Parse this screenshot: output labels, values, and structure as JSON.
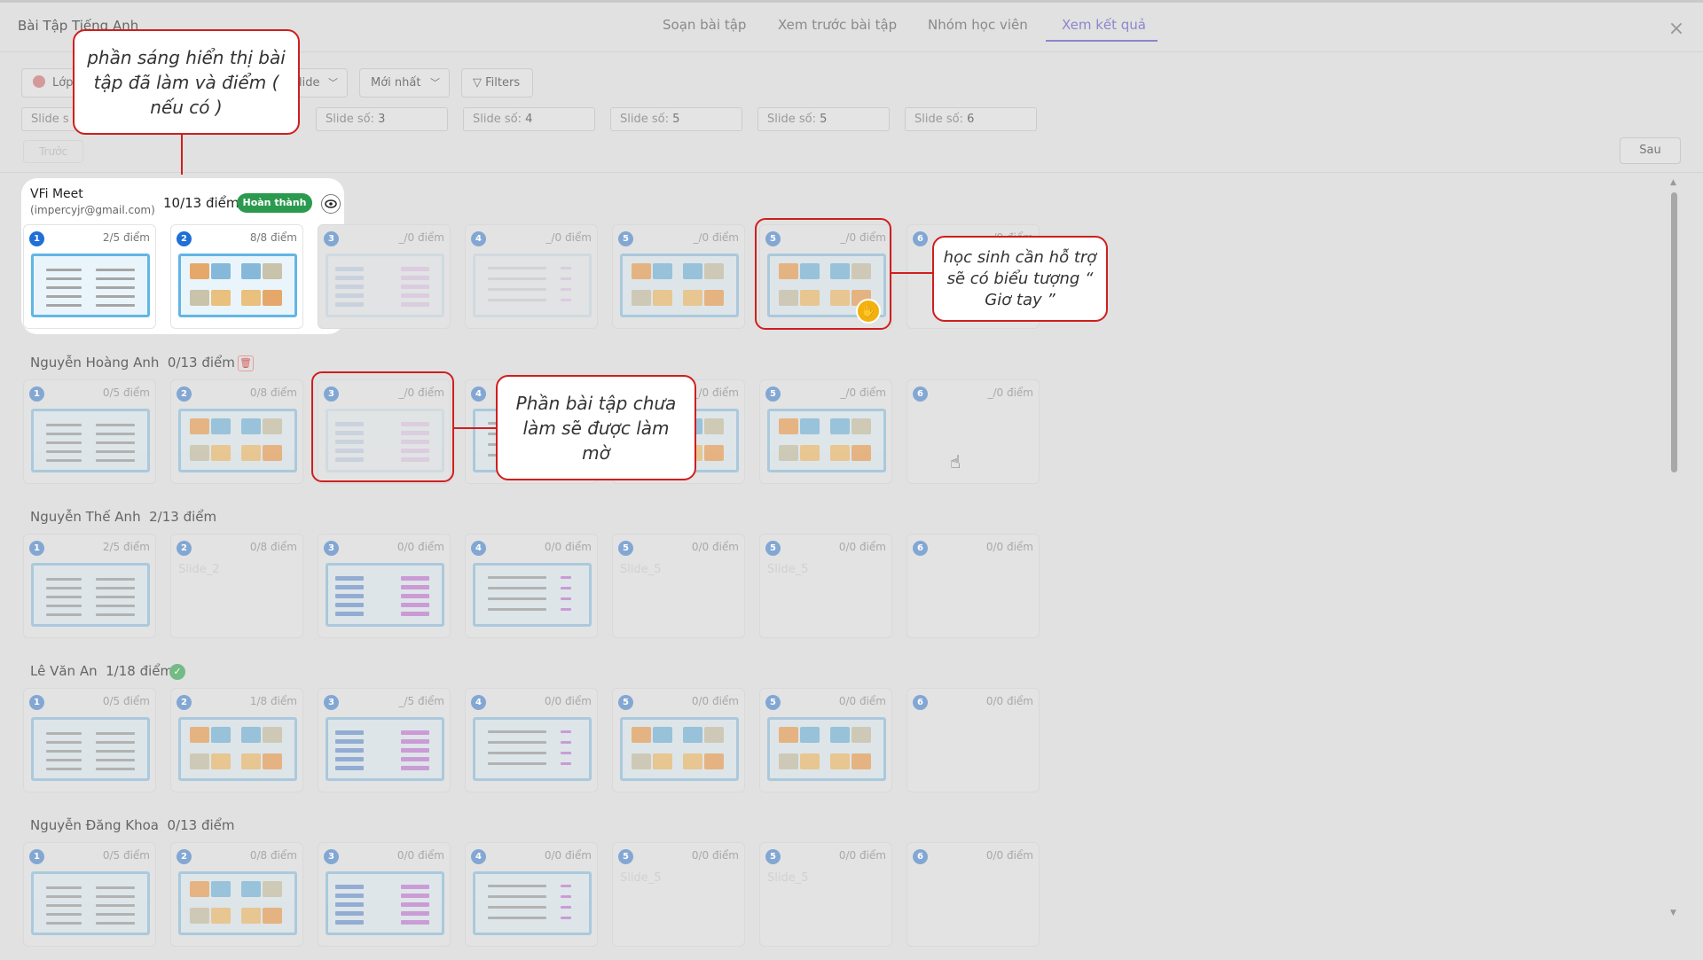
{
  "header": {
    "app_title": "Bài Tập Tiếng Anh",
    "tabs": [
      "Soạn bài tập",
      "Xem trước bài tập",
      "Nhóm học viên",
      "Xem kết quả"
    ],
    "active_tab": "Xem kết quả",
    "close_icon": "close-icon"
  },
  "toolbar": {
    "class_label": "Lớp",
    "slide_label": "lide",
    "sort_label": "Mới nhất",
    "filters_label": "Filters",
    "slide_fields": [
      {
        "prefix": "Slide s",
        "value": ""
      },
      {
        "prefix": "Slide số:",
        "value": "3"
      },
      {
        "prefix": "Slide số:",
        "value": "4"
      },
      {
        "prefix": "Slide số:",
        "value": "5"
      },
      {
        "prefix": "Slide số:",
        "value": "5"
      },
      {
        "prefix": "Slide số:",
        "value": "6"
      }
    ],
    "prev_label": "Trước",
    "next_label": "Sau"
  },
  "highlight_student": {
    "name": "VFi Meet",
    "email": "(impercyjr@gmail.com)",
    "score": "10/13 điểm",
    "status": "Hoàn thành",
    "view_icon": "eye-icon",
    "cards": [
      {
        "num": "1",
        "score": "2/5 điểm"
      },
      {
        "num": "2",
        "score": "8/8 điểm"
      },
      {
        "num": "3",
        "score": "_/0 điểm"
      },
      {
        "num": "4",
        "score": "_/0 điểm"
      },
      {
        "num": "5",
        "score": "_/0 điểm"
      },
      {
        "num": "5",
        "score": "_/0 điểm"
      },
      {
        "num": "6",
        "score": "_/0 điểm"
      }
    ]
  },
  "students": [
    {
      "name": "Nguyễn Hoàng Anh",
      "score": "0/13 điểm",
      "icon": "trash-icon",
      "cards": [
        {
          "num": "1",
          "score": "0/5 điểm"
        },
        {
          "num": "2",
          "score": "0/8 điểm"
        },
        {
          "num": "3",
          "score": "_/0 điểm"
        },
        {
          "num": "4",
          "score": ""
        },
        {
          "num": "5",
          "score": "_/0 điểm"
        },
        {
          "num": "5",
          "score": "_/0 điểm"
        },
        {
          "num": "6",
          "score": "_/0 điểm"
        }
      ]
    },
    {
      "name": "Nguyễn Thế Anh",
      "score": "2/13 điểm",
      "icon": "",
      "cards": [
        {
          "num": "1",
          "score": "2/5 điểm"
        },
        {
          "num": "2",
          "score": "0/8 điểm",
          "ghost": "Slide_2"
        },
        {
          "num": "3",
          "score": "0/0 điểm"
        },
        {
          "num": "4",
          "score": "0/0 điểm"
        },
        {
          "num": "5",
          "score": "0/0 điểm",
          "ghost": "Slide_5"
        },
        {
          "num": "5",
          "score": "0/0 điểm",
          "ghost": "Slide_5"
        },
        {
          "num": "6",
          "score": "0/0 điểm"
        }
      ]
    },
    {
      "name": "Lê Văn An",
      "score": "1/18 điểm",
      "icon": "check-circle-icon",
      "cards": [
        {
          "num": "1",
          "score": "0/5 điểm"
        },
        {
          "num": "2",
          "score": "1/8 điểm"
        },
        {
          "num": "3",
          "score": "_/5 điểm"
        },
        {
          "num": "4",
          "score": "0/0 điểm"
        },
        {
          "num": "5",
          "score": "0/0 điểm"
        },
        {
          "num": "5",
          "score": "0/0 điểm"
        },
        {
          "num": "6",
          "score": "0/0 điểm"
        }
      ]
    },
    {
      "name": "Nguyễn Đăng Khoa",
      "score": "0/13 điểm",
      "icon": "",
      "cards": [
        {
          "num": "1",
          "score": "0/5 điểm"
        },
        {
          "num": "2",
          "score": "0/8 điểm"
        },
        {
          "num": "3",
          "score": "0/0 điểm"
        },
        {
          "num": "4",
          "score": "0/0 điểm"
        },
        {
          "num": "5",
          "score": "0/0 điểm",
          "ghost": "Slide_5"
        },
        {
          "num": "5",
          "score": "0/0 điểm",
          "ghost": "Slide_5"
        },
        {
          "num": "6",
          "score": "0/0 điểm"
        }
      ]
    }
  ],
  "annotations": {
    "highlight_note": "phần sáng hiển thị bài tập đã làm và điểm ( nếu có )",
    "raise_hand_note": "học sinh cần hỗ trợ sẽ có biểu tượng “ Giơ tay ”",
    "blur_note": "Phần bài tập chưa làm sẽ được làm mờ"
  },
  "colors": {
    "accent": "#8b86cc",
    "success": "#2b9a4f",
    "annotation": "#d01e1e",
    "raise_hand": "#f2b10c"
  }
}
